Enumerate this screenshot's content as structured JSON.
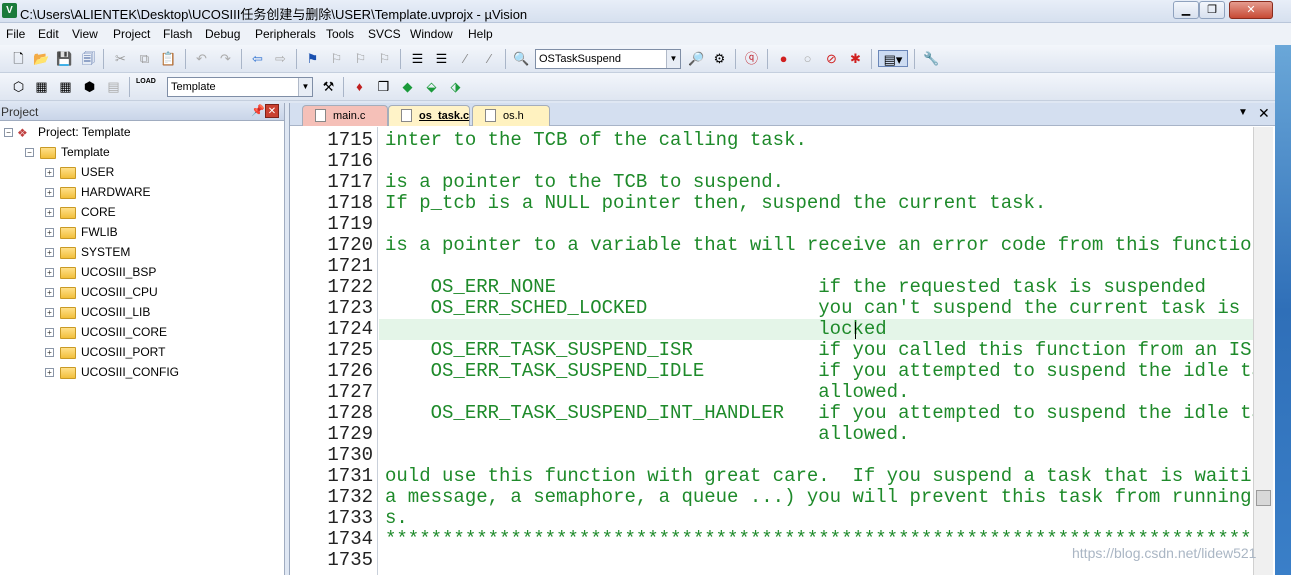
{
  "window": {
    "title": "C:\\Users\\ALIENTEK\\Desktop\\UCOSIII任务创建与删除\\USER\\Template.uvprojx - µVision",
    "app_icon": "V"
  },
  "menu": [
    "File",
    "Edit",
    "View",
    "Project",
    "Flash",
    "Debug",
    "Peripherals",
    "Tools",
    "SVCS",
    "Window",
    "Help"
  ],
  "toolbar": {
    "find_value": "OSTaskSuspend",
    "target_value": "Template"
  },
  "project_panel": {
    "title": "Project",
    "root": "Project: Template",
    "target": "Template",
    "groups": [
      "USER",
      "HARDWARE",
      "CORE",
      "FWLIB",
      "SYSTEM",
      "UCOSIII_BSP",
      "UCOSIII_CPU",
      "UCOSIII_LIB",
      "UCOSIII_CORE",
      "UCOSIII_PORT",
      "UCOSIII_CONFIG"
    ]
  },
  "tabs": [
    "main.c",
    "os_task.c",
    "os.h"
  ],
  "active_tab": "os_task.c",
  "code": {
    "line_numbers": [
      "1715",
      "1716",
      "1717",
      "1718",
      "1719",
      "1720",
      "1721",
      "1722",
      "1723",
      "1724",
      "1725",
      "1726",
      "1727",
      "1728",
      "1729",
      "1730",
      "1731",
      "1732",
      "1733",
      "1734",
      "1735"
    ],
    "lines": [
      "inter to the TCB of the calling task.",
      "",
      "is a pointer to the TCB to suspend.",
      "If p_tcb is a NULL pointer then, suspend the current task.",
      "",
      "is a pointer to a variable that will receive an error code from this function.",
      "",
      "    OS_ERR_NONE                       if the requested task is suspended",
      "    OS_ERR_SCHED_LOCKED               you can't suspend the current task is the",
      "                                      locked",
      "    OS_ERR_TASK_SUSPEND_ISR           if you called this function from an ISR",
      "    OS_ERR_TASK_SUSPEND_IDLE          if you attempted to suspend the idle task w",
      "                                      allowed.",
      "    OS_ERR_TASK_SUSPEND_INT_HANDLER   if you attempted to suspend the idle task w",
      "                                      allowed.",
      "",
      "ould use this function with great care.  If you suspend a task that is waiting f",
      "a message, a semaphore, a queue ...) you will prevent this task from running whe",
      "s.",
      "**********************************************************************************",
      ""
    ]
  },
  "watermark": "https://blog.csdn.net/lidew521"
}
